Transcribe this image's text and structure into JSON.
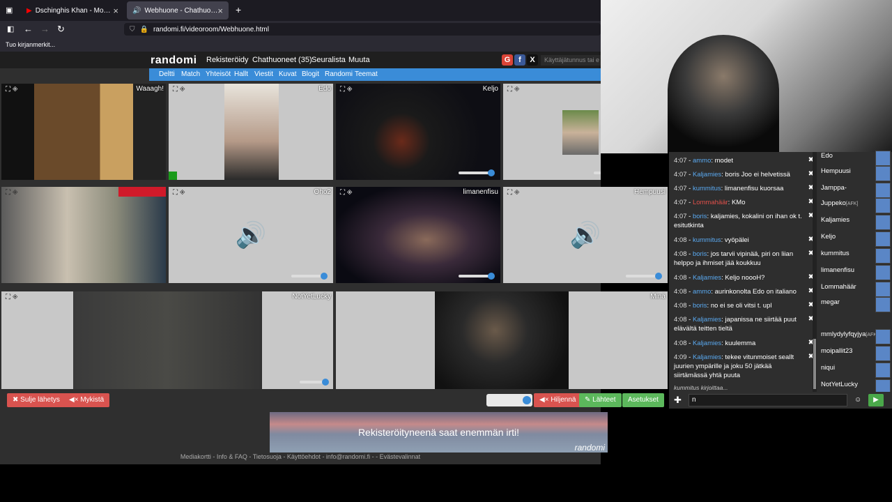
{
  "browser": {
    "tabs": [
      {
        "label": "Dschinghis Khan - Moskau (Sta"
      },
      {
        "label": "Webhuone - Chathuoneet"
      }
    ],
    "new_tab": "+",
    "url": "randomi.fi/videoroom/Webhuone.html",
    "bookmark": "Tuo kirjanmerkit..."
  },
  "site": {
    "logo": "randomi",
    "nav": [
      "Rekisteröidy",
      "Chathuoneet (35)",
      "Seuralista",
      "Muuta"
    ],
    "subnav": [
      "Deltti",
      "Match",
      "Yhteisöt",
      "Hallt",
      "Viestit",
      "Kuvat",
      "Blogit",
      "Randomi",
      "Teemat"
    ],
    "login_placeholder": "Käyttäjätunnus tai e",
    "social": [
      {
        "icon": "google-icon",
        "color": "#db4437",
        "glyph": "G"
      },
      {
        "icon": "facebook-icon",
        "color": "#3b5998",
        "glyph": "f"
      },
      {
        "icon": "x-icon",
        "color": "#111",
        "glyph": "X"
      }
    ]
  },
  "tiles": [
    {
      "name": "Waaagh!"
    },
    {
      "name": "Edo"
    },
    {
      "name": "Keljo"
    },
    {
      "name": ""
    },
    {
      "name": ""
    },
    {
      "name": "Oho2"
    },
    {
      "name": "limanenfisu"
    },
    {
      "name": "Hempuusi"
    },
    {
      "name": ""
    },
    {
      "name": "NotYetLucky"
    },
    {
      "name": "Minä"
    }
  ],
  "buttons": {
    "close": "Sulje lähetys",
    "mute": "Mykistä",
    "quiet": "Hiljennä",
    "sources": "Lähteet",
    "settings": "Asetukset"
  },
  "banner": "Rekisteröityneenä saat enemmän irti!",
  "banner_brand": "randomi",
  "footer": "Mediakortti - Info & FAQ - Tietosuoja - Käyttöehdot - info@randomi.fi - - Evästevalinnat",
  "chat": [
    {
      "time": "4:07",
      "nick": "ammo",
      "text": "modet"
    },
    {
      "time": "4:07",
      "nick": "Kaljamies",
      "text": "boris Joo ei helvetissä"
    },
    {
      "time": "4:07",
      "nick": "kummitus",
      "text": "limanenfisu kuorsaa"
    },
    {
      "time": "4:07",
      "nick": "Lommahäär",
      "text": "KMo"
    },
    {
      "time": "4:07",
      "nick": "boris",
      "text": "kaljamies, kokalini on ihan ok t. esitutkinta"
    },
    {
      "time": "4:08",
      "nick": "kummitus",
      "text": "vyöpälei"
    },
    {
      "time": "4:08",
      "nick": "boris",
      "text": "jos tarvii vipinää, piri on liian helppo ja ihmiset jää koukkuu"
    },
    {
      "time": "4:08",
      "nick": "Kaljamies",
      "text": "Keljo noooH?"
    },
    {
      "time": "4:08",
      "nick": "ammo",
      "text": "aurinkonolta Edo on italiano"
    },
    {
      "time": "4:08",
      "nick": "boris",
      "text": "no ei se oli vitsi t. upl"
    },
    {
      "time": "4:08",
      "nick": "Kaljamies",
      "text": "japanissa ne siirtää puut elävältä teitten tieltä"
    },
    {
      "time": "4:08",
      "nick": "Kaljamies",
      "text": "kuulemma"
    },
    {
      "time": "4:09",
      "nick": "Kaljamies",
      "text": "tekee vitunmoiset seallt juurien ympärille ja joku 50 jätkää siirtämässä yhtä puuta"
    }
  ],
  "typing": "kummitus kirjoittaa...",
  "chat_input": "n",
  "users": [
    {
      "name": "Edo",
      "afk": ""
    },
    {
      "name": "Hempuusi",
      "afk": ""
    },
    {
      "name": "Jamppa-",
      "afk": ""
    },
    {
      "name": "Juppeko",
      "afk": "[AFK]"
    },
    {
      "name": "Kaljamies",
      "afk": ""
    },
    {
      "name": "Keljo",
      "afk": ""
    },
    {
      "name": "kummitus",
      "afk": ""
    },
    {
      "name": "limanenfisu",
      "afk": ""
    },
    {
      "name": "Lommahäär",
      "afk": ""
    },
    {
      "name": "megar",
      "afk": ""
    },
    {
      "name": "mmlydylyfqyjya",
      "afk": "[AFK]"
    },
    {
      "name": "moipallit23",
      "afk": ""
    },
    {
      "name": "niqui",
      "afk": ""
    },
    {
      "name": "NotYetLucky",
      "afk": ""
    }
  ]
}
